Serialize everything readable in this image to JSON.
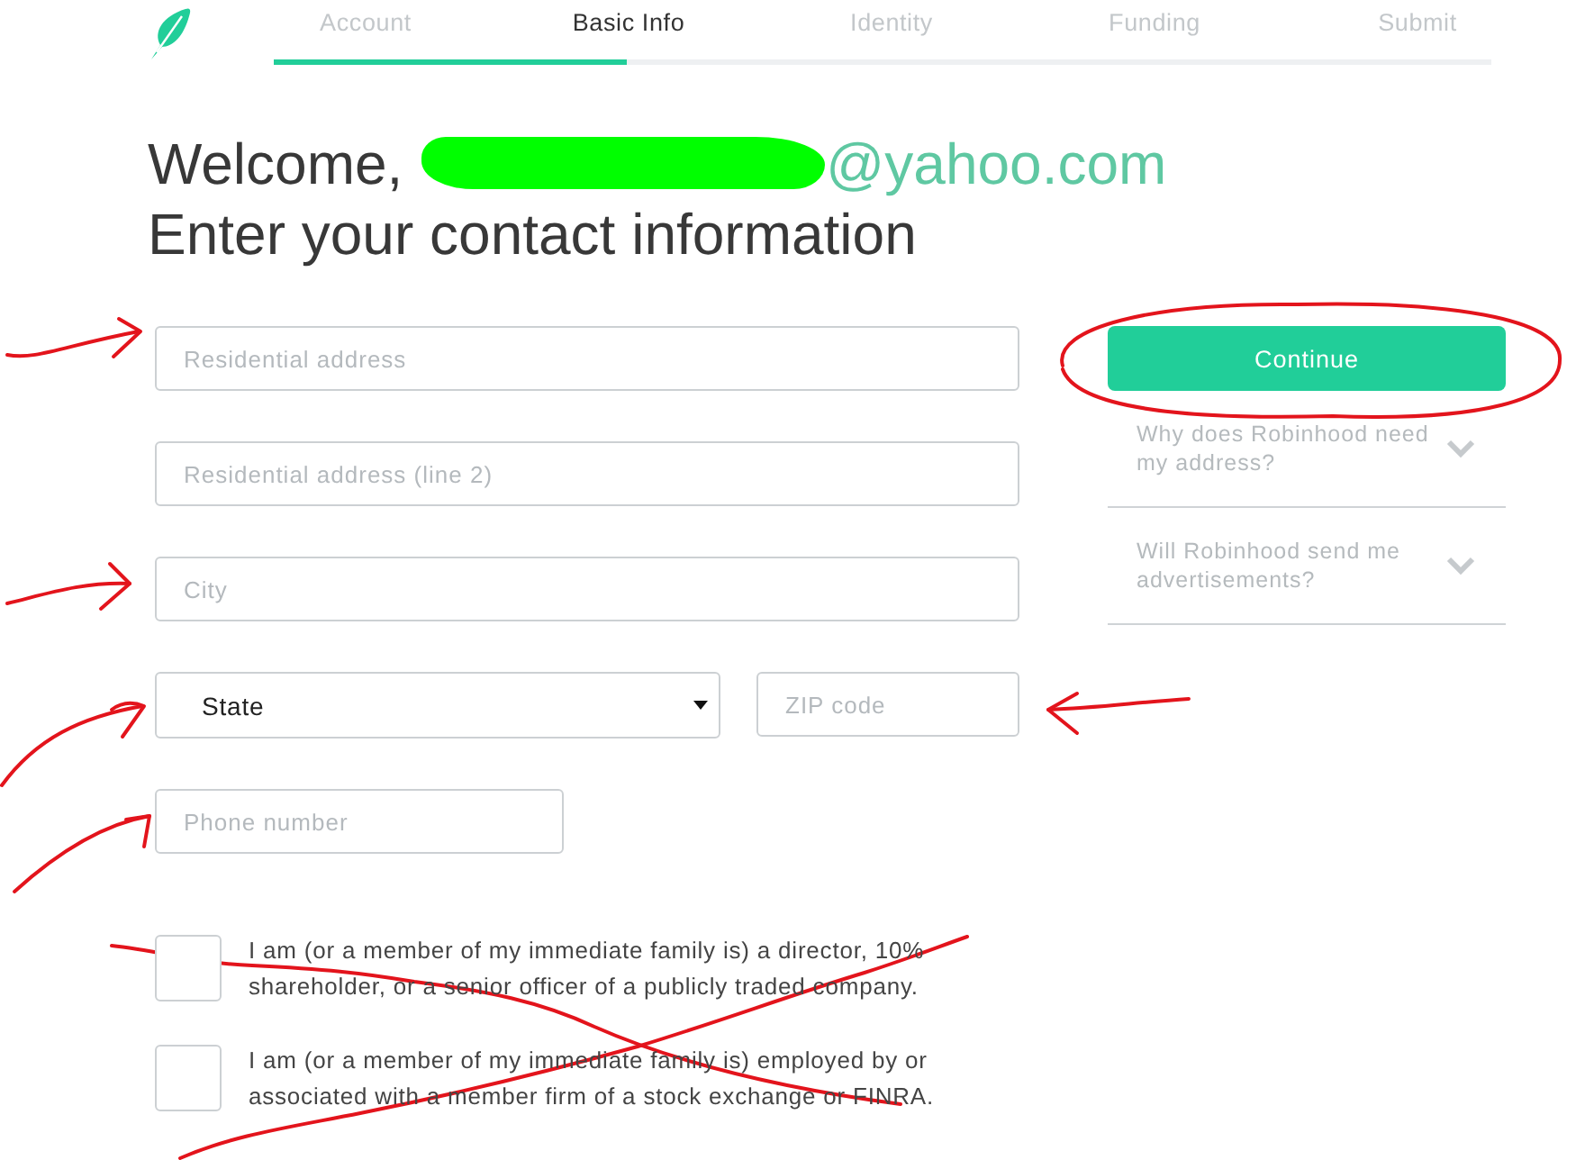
{
  "steps": [
    {
      "label": "Account",
      "selected": false
    },
    {
      "label": "Basic Info",
      "selected": true
    },
    {
      "label": "Identity",
      "selected": false
    },
    {
      "label": "Funding",
      "selected": false
    },
    {
      "label": "Submit",
      "selected": false
    }
  ],
  "progress": {
    "level": 0.29
  },
  "heading": {
    "greeting": "Welcome,",
    "email_redacted": true,
    "email_domain": "@yahoo.com",
    "subtitle": "Enter your contact information"
  },
  "field_rows": [
    [
      {
        "kind": "text",
        "placeholder": "Residential address"
      }
    ],
    [
      {
        "kind": "text",
        "placeholder": "Residential address (line 2)"
      }
    ],
    [
      {
        "kind": "text",
        "placeholder": "City"
      }
    ],
    [
      {
        "kind": "select",
        "value": "State"
      },
      {
        "kind": "postal",
        "placeholder": "ZIP code"
      }
    ],
    [
      {
        "kind": "phone",
        "placeholder": "Phone number"
      }
    ]
  ],
  "continue_button": {
    "label": "Continue"
  },
  "faq": [
    {
      "question": "Why does Robinhood need my address?",
      "expanded": false
    },
    {
      "question": "Will Robinhood send me advertisements?",
      "expanded": false
    }
  ],
  "declarations": [
    {
      "text": "I am (or a member of my immediate family is) a director, 10% shareholder, or a senior officer of a publicly traded company.",
      "checked": false
    },
    {
      "text": "I am (or a member of my immediate family is) employed by or associated with a member firm of a stock exchange or FINRA.",
      "checked": false
    }
  ]
}
